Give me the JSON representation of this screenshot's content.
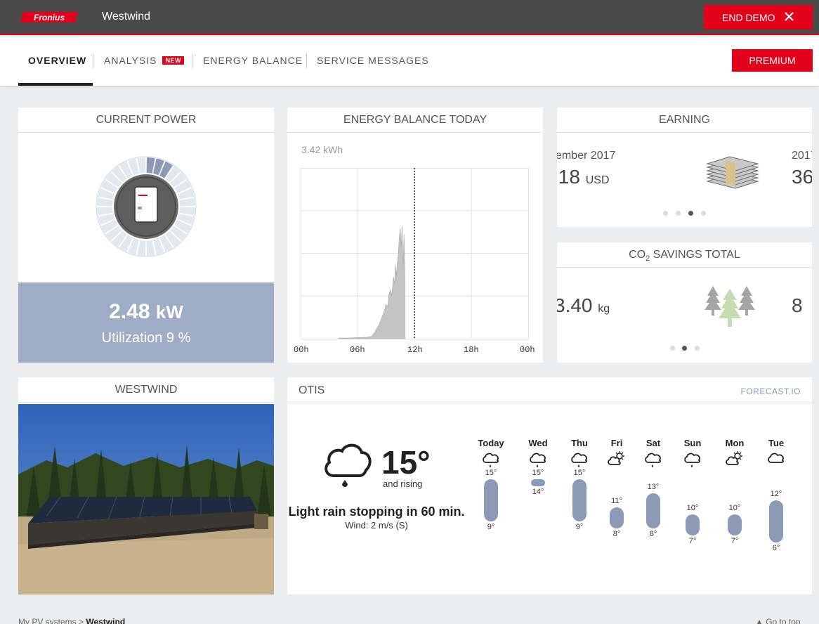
{
  "header": {
    "brand": "Fronius",
    "system_name": "Westwind",
    "end_demo_label": "END DEMO"
  },
  "nav": {
    "tabs": [
      {
        "label": "OVERVIEW"
      },
      {
        "label": "ANALYSIS",
        "badge": "NEW"
      },
      {
        "label": "ENERGY BALANCE"
      },
      {
        "label": "SERVICE MESSAGES"
      }
    ],
    "premium_label": "PREMIUM"
  },
  "current_power": {
    "title": "CURRENT POWER",
    "value": "2.48",
    "unit": "kW",
    "utilization": "Utilization 9 %",
    "ring_fill_fraction": 0.09
  },
  "energy_balance": {
    "title": "ENERGY BALANCE TODAY",
    "total": "3.42 kWh",
    "x_labels": [
      "00h",
      "06h",
      "12h",
      "18h",
      "00h"
    ],
    "now_hour": 12.0
  },
  "earning": {
    "title": "EARNING",
    "month_left": "ember 2017",
    "value_left": ".18",
    "currency": "USD",
    "month_right": "2017",
    "value_right": "36",
    "active_dot": 2
  },
  "co2": {
    "title": "CO",
    "title_sub": "2",
    "title_rest": " SAVINGS TOTAL",
    "value_left": "3.40",
    "unit": "kg",
    "value_right": "8",
    "active_dot": 1
  },
  "system_photo": {
    "title": "WESTWIND"
  },
  "weather": {
    "city": "OTIS",
    "source": "FORECAST.IO",
    "temperature": "15°",
    "trend": "and rising",
    "summary": "Light rain stopping in 60 min.",
    "wind": "Wind: 2 m/s (S)",
    "days": [
      {
        "day": "Today",
        "high": "15°",
        "low": "9°",
        "hi": 15,
        "lo": 9,
        "icon": "rain-icon"
      },
      {
        "day": "Wed",
        "high": "15°",
        "low": "14°",
        "hi": 15,
        "lo": 14,
        "icon": "rain-icon"
      },
      {
        "day": "Thu",
        "high": "15°",
        "low": "9°",
        "hi": 15,
        "lo": 9,
        "icon": "rain-icon"
      },
      {
        "day": "Fri",
        "high": "11°",
        "low": "8°",
        "hi": 11,
        "lo": 8,
        "icon": "partly-cloudy-icon"
      },
      {
        "day": "Sat",
        "high": "13°",
        "low": "8°",
        "hi": 13,
        "lo": 8,
        "icon": "rain-icon"
      },
      {
        "day": "Sun",
        "high": "10°",
        "low": "7°",
        "hi": 10,
        "lo": 7,
        "icon": "rain-icon"
      },
      {
        "day": "Mon",
        "high": "10°",
        "low": "7°",
        "hi": 10,
        "lo": 7,
        "icon": "partly-cloudy-icon"
      },
      {
        "day": "Tue",
        "high": "12°",
        "low": "6°",
        "hi": 12,
        "lo": 6,
        "icon": "cloudy-icon"
      }
    ]
  },
  "footer": {
    "crumb_root": "My PV systems",
    "crumb_current": "Westwind",
    "go_top": "Go to top"
  },
  "colors": {
    "accent": "#e2001a",
    "topbar": "#4a4a4a",
    "panel_blue": "#9facc5",
    "bar_blue": "#8d9ab6"
  }
}
